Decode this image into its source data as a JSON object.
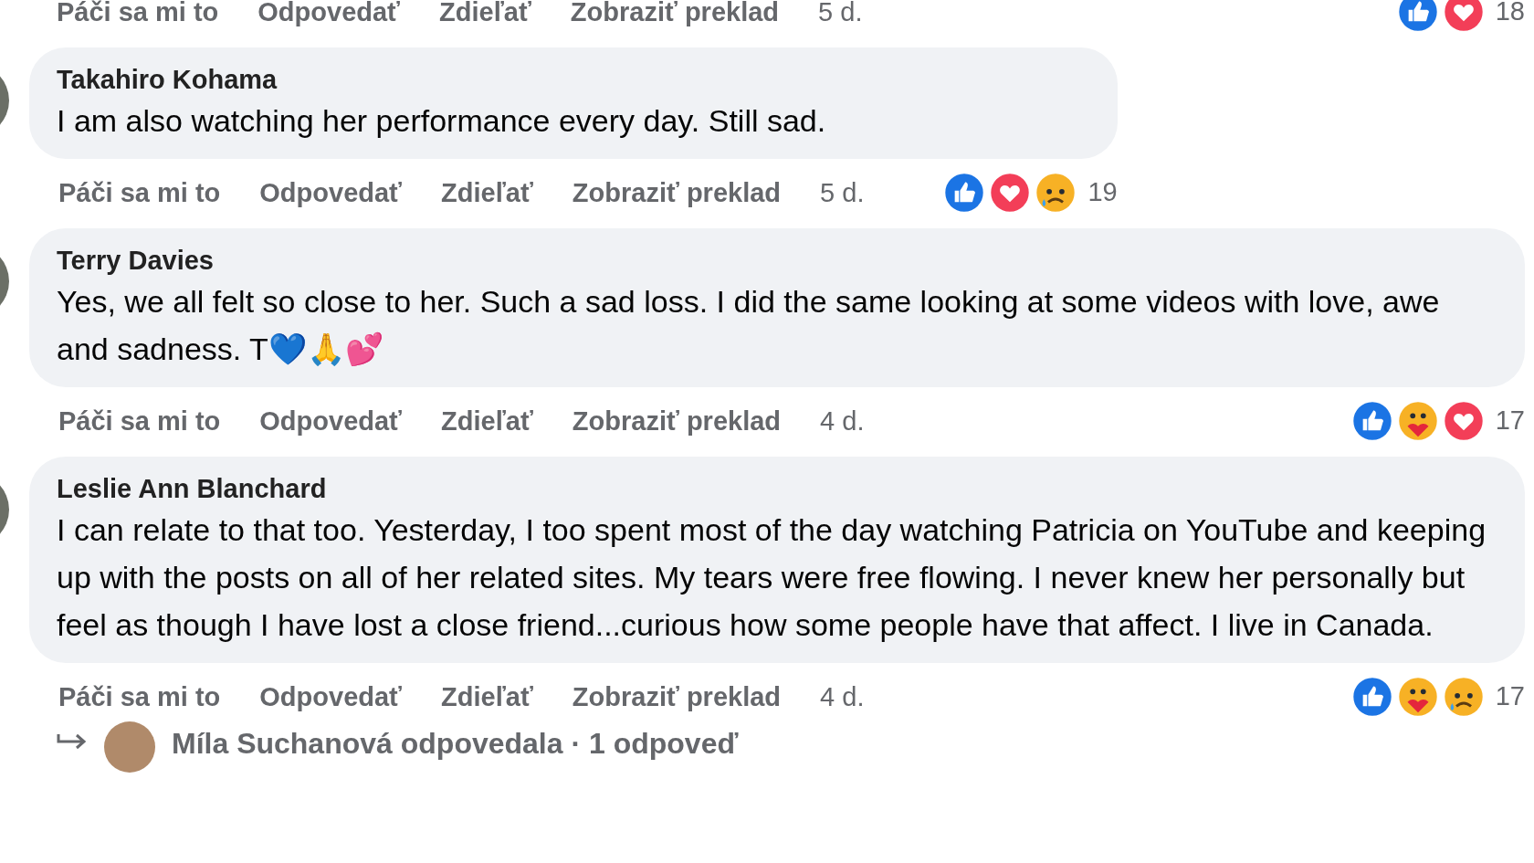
{
  "previous_comment": {
    "actions": [
      "Páči sa mi to",
      "Odpovedať",
      "Zdieľať",
      "Zobraziť preklad"
    ],
    "time": "5 d.",
    "reactions": [
      {
        "kind": "like"
      },
      {
        "kind": "love"
      }
    ],
    "count": "18"
  },
  "comments": [
    {
      "author": "Takahiro Kohama",
      "text": "I am also watching her performance every day. Still sad.",
      "actions": [
        "Páči sa mi to",
        "Odpovedať",
        "Zdieľať",
        "Zobraziť preklad"
      ],
      "time": "5 d.",
      "reactions": [
        {
          "kind": "like"
        },
        {
          "kind": "love"
        },
        {
          "kind": "sad"
        }
      ],
      "count": "19"
    },
    {
      "author": "Terry Davies",
      "text": "Yes, we all felt so close to her. Such a sad loss. I did the same looking at some videos with love, awe and sadness. T💙🙏💕",
      "actions": [
        "Páči sa mi to",
        "Odpovedať",
        "Zdieľať",
        "Zobraziť preklad"
      ],
      "time": "4 d.",
      "reactions": [
        {
          "kind": "like"
        },
        {
          "kind": "care"
        },
        {
          "kind": "love"
        }
      ],
      "count": "17"
    },
    {
      "author": "Leslie Ann Blanchard",
      "text": "I can relate to that too. Yesterday, I too spent most of the day watching Patricia on YouTube and keeping up with the posts on all of her related sites. My tears were free flowing. I never knew her personally but feel as though I have lost a close friend...curious how some people have that affect. I live in Canada.",
      "actions": [
        "Páči sa mi to",
        "Odpovedať",
        "Zdieľať",
        "Zobraziť preklad"
      ],
      "time": "4 d.",
      "reactions": [
        {
          "kind": "like"
        },
        {
          "kind": "care"
        },
        {
          "kind": "sad"
        }
      ],
      "count": "17"
    }
  ],
  "reply_link": {
    "text": "Míla Suchanová odpovedala · 1 odpoveď"
  }
}
